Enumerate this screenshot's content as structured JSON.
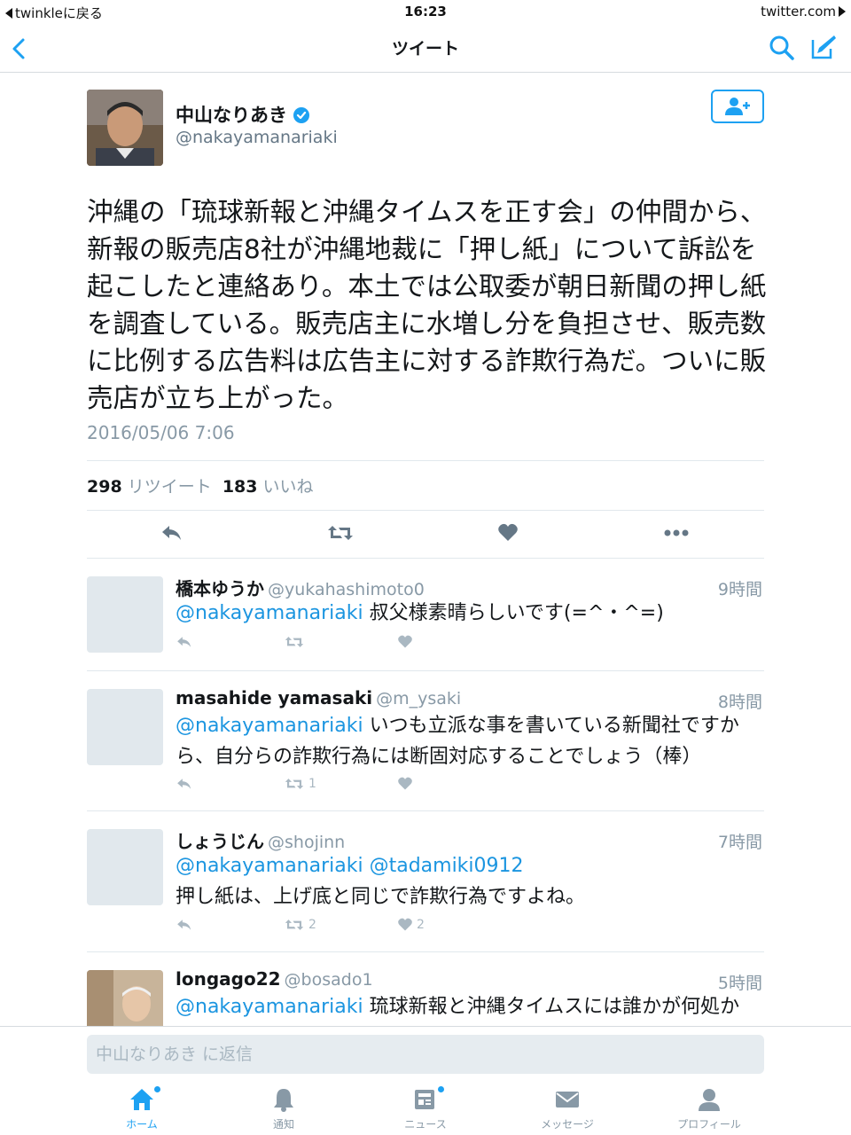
{
  "status_bar": {
    "back_app": "twinkleに戻る",
    "time": "16:23",
    "site": "twitter.com"
  },
  "nav": {
    "title": "ツイート"
  },
  "tweet": {
    "author_name": "中山なりあき",
    "author_handle": "@nakayamanariaki",
    "text": "沖縄の「琉球新報と沖縄タイムスを正す会」の仲間から、新報の販売店8社が沖縄地裁に「押し紙」について訴訟を起こしたと連絡あり。本土では公取委が朝日新聞の押し紙を調査している。販売店主に水増し分を負担させ、販売数に比例する広告料は広告主に対する詐欺行為だ。ついに販売店が立ち上がった。",
    "date": "2016/05/06 7:06",
    "retweet_count": "298",
    "retweet_label": "リツイート",
    "like_count": "183",
    "like_label": "いいね"
  },
  "replies": [
    {
      "name": "橋本ゆうか",
      "handle": "@yukahashimoto0",
      "time": "9時間",
      "mention": "@nakayamanariaki",
      "text": " 叔父様素晴らしいです(=^・^=)",
      "retweets": "",
      "likes": ""
    },
    {
      "name": "masahide yamasaki",
      "handle": "@m_ysaki",
      "time": "8時間",
      "mention": "@nakayamanariaki",
      "text": " いつも立派な事を書いている新聞社ですから、自分らの詐欺行為には断固対応することでしょう（棒）",
      "retweets": "1",
      "likes": ""
    },
    {
      "name": "しょうじん",
      "handle": "@shojinn",
      "time": "7時間",
      "mention": "@nakayamanariaki @tadamiki0912",
      "text": "押し紙は、上げ底と同じで詐欺行為ですよね。",
      "retweets": "2",
      "likes": "2"
    },
    {
      "name": "longago22",
      "handle": "@bosado1",
      "time": "5時間",
      "mention": "@nakayamanariaki",
      "text": " 琉球新報と沖縄タイムスには誰かが何処か"
    }
  ],
  "reply_box": {
    "placeholder": "中山なりあき に返信"
  },
  "tabs": [
    {
      "label": "ホーム",
      "icon": "home-icon",
      "active": true
    },
    {
      "label": "通知",
      "icon": "bell-icon"
    },
    {
      "label": "ニュース",
      "icon": "news-icon"
    },
    {
      "label": "メッセージ",
      "icon": "envelope-icon"
    },
    {
      "label": "プロフィール",
      "icon": "person-icon"
    }
  ],
  "colors": {
    "accent": "#1da1f2",
    "link": "#1b95e0",
    "muted": "#8899a6"
  }
}
